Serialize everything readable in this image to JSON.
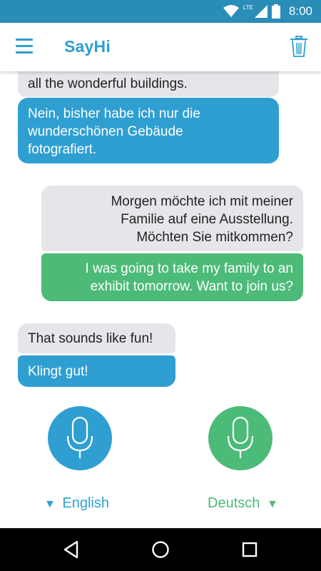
{
  "status_bar": {
    "network_label": "LTE",
    "time": "8:00"
  },
  "app_bar": {
    "title": "SayHi"
  },
  "messages": [
    {
      "original": "all the wonderful buildings.",
      "translation": [
        "Nein, bisher habe ich nur die",
        "wunderschönen Gebäude",
        "fotografiert."
      ]
    },
    {
      "original": [
        "Morgen möchte ich mit meiner",
        "Familie auf eine Ausstellung.",
        "Möchten Sie mitkommen?"
      ],
      "translation": [
        "I was going to take my family to an",
        "exhibit tomorrow. Want to join us?"
      ]
    },
    {
      "original": "That sounds like fun!",
      "translation": "Klingt gut!"
    }
  ],
  "languages": {
    "left": {
      "arrow": "▼",
      "label": "English"
    },
    "right": {
      "arrow": "▼",
      "label": "Deutsch"
    }
  },
  "colors": {
    "accent_blue": "#2f9fd2",
    "accent_green": "#4cbb78",
    "bubble_gray": "#e6e6ea",
    "status_bar": "#2a8db8"
  },
  "icons": {
    "menu": "hamburger-menu-icon",
    "trash": "trash-icon",
    "mic": "microphone-icon",
    "back": "back-triangle-icon",
    "home": "home-circle-icon",
    "recents": "recents-square-icon"
  }
}
